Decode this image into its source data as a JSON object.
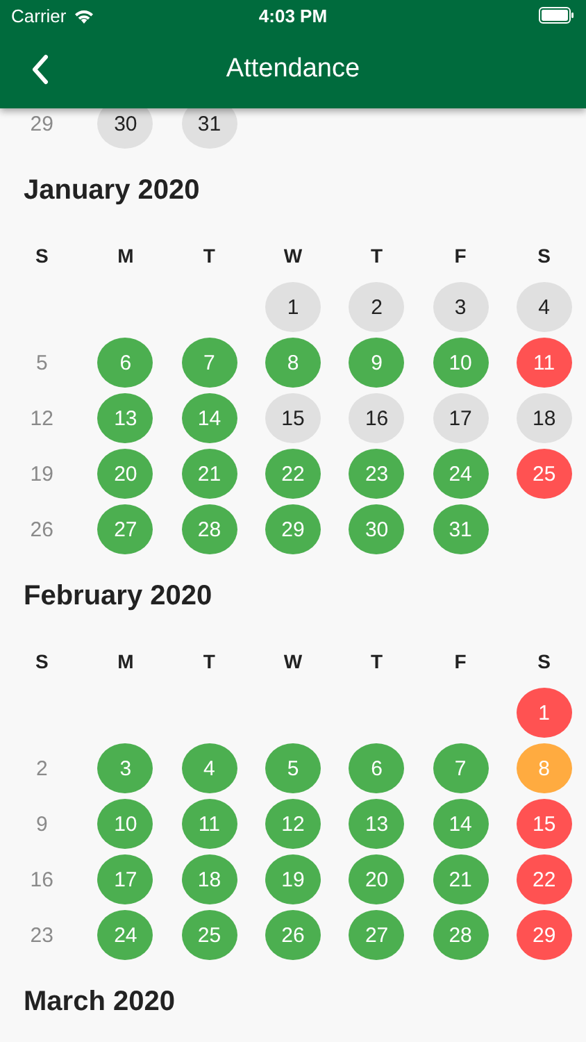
{
  "status_bar": {
    "carrier": "Carrier",
    "time": "4:03 PM"
  },
  "header": {
    "title": "Attendance"
  },
  "months": [
    {
      "kind": "partial",
      "weeks": [
        {
          "kind": "normal",
          "days": [
            {
              "day": "29",
              "kind": "plain"
            },
            {
              "day": "30",
              "kind": "holiday"
            },
            {
              "day": "31",
              "kind": "holiday"
            }
          ]
        }
      ]
    },
    {
      "kind": "full",
      "title": "January 2020",
      "weekdays": [
        "S",
        "M",
        "T",
        "W",
        "T",
        "F",
        "S"
      ],
      "weeks": [
        {
          "kind": "first",
          "days": [
            {
              "day": "1",
              "kind": "holiday"
            },
            {
              "day": "2",
              "kind": "holiday"
            },
            {
              "day": "3",
              "kind": "holiday"
            },
            {
              "day": "4",
              "kind": "holiday"
            }
          ]
        },
        {
          "kind": "normal",
          "days": [
            {
              "day": "5",
              "kind": "plain"
            },
            {
              "day": "6",
              "kind": "present"
            },
            {
              "day": "7",
              "kind": "present"
            },
            {
              "day": "8",
              "kind": "present"
            },
            {
              "day": "9",
              "kind": "present"
            },
            {
              "day": "10",
              "kind": "present"
            },
            {
              "day": "11",
              "kind": "absent"
            }
          ]
        },
        {
          "kind": "normal",
          "days": [
            {
              "day": "12",
              "kind": "plain"
            },
            {
              "day": "13",
              "kind": "present"
            },
            {
              "day": "14",
              "kind": "present"
            },
            {
              "day": "15",
              "kind": "holiday"
            },
            {
              "day": "16",
              "kind": "holiday"
            },
            {
              "day": "17",
              "kind": "holiday"
            },
            {
              "day": "18",
              "kind": "holiday"
            }
          ]
        },
        {
          "kind": "normal",
          "days": [
            {
              "day": "19",
              "kind": "plain"
            },
            {
              "day": "20",
              "kind": "present"
            },
            {
              "day": "21",
              "kind": "present"
            },
            {
              "day": "22",
              "kind": "present"
            },
            {
              "day": "23",
              "kind": "present"
            },
            {
              "day": "24",
              "kind": "present"
            },
            {
              "day": "25",
              "kind": "absent"
            }
          ]
        },
        {
          "kind": "normal",
          "days": [
            {
              "day": "26",
              "kind": "plain"
            },
            {
              "day": "27",
              "kind": "present"
            },
            {
              "day": "28",
              "kind": "present"
            },
            {
              "day": "29",
              "kind": "present"
            },
            {
              "day": "30",
              "kind": "present"
            },
            {
              "day": "31",
              "kind": "present"
            }
          ]
        }
      ]
    },
    {
      "kind": "full",
      "title": "February 2020",
      "weekdays": [
        "S",
        "M",
        "T",
        "W",
        "T",
        "F",
        "S"
      ],
      "weeks": [
        {
          "kind": "first",
          "days": [
            {
              "day": "1",
              "kind": "absent"
            }
          ]
        },
        {
          "kind": "normal",
          "days": [
            {
              "day": "2",
              "kind": "plain"
            },
            {
              "day": "3",
              "kind": "present"
            },
            {
              "day": "4",
              "kind": "present"
            },
            {
              "day": "5",
              "kind": "present"
            },
            {
              "day": "6",
              "kind": "present"
            },
            {
              "day": "7",
              "kind": "present"
            },
            {
              "day": "8",
              "kind": "late"
            }
          ]
        },
        {
          "kind": "normal",
          "days": [
            {
              "day": "9",
              "kind": "plain"
            },
            {
              "day": "10",
              "kind": "present"
            },
            {
              "day": "11",
              "kind": "present"
            },
            {
              "day": "12",
              "kind": "present"
            },
            {
              "day": "13",
              "kind": "present"
            },
            {
              "day": "14",
              "kind": "present"
            },
            {
              "day": "15",
              "kind": "absent"
            }
          ]
        },
        {
          "kind": "normal",
          "days": [
            {
              "day": "16",
              "kind": "plain"
            },
            {
              "day": "17",
              "kind": "present"
            },
            {
              "day": "18",
              "kind": "present"
            },
            {
              "day": "19",
              "kind": "present"
            },
            {
              "day": "20",
              "kind": "present"
            },
            {
              "day": "21",
              "kind": "present"
            },
            {
              "day": "22",
              "kind": "absent"
            }
          ]
        },
        {
          "kind": "normal",
          "days": [
            {
              "day": "23",
              "kind": "plain"
            },
            {
              "day": "24",
              "kind": "present"
            },
            {
              "day": "25",
              "kind": "present"
            },
            {
              "day": "26",
              "kind": "present"
            },
            {
              "day": "27",
              "kind": "present"
            },
            {
              "day": "28",
              "kind": "present"
            },
            {
              "day": "29",
              "kind": "absent"
            }
          ]
        }
      ]
    },
    {
      "kind": "title_only",
      "title": "March 2020"
    }
  ]
}
